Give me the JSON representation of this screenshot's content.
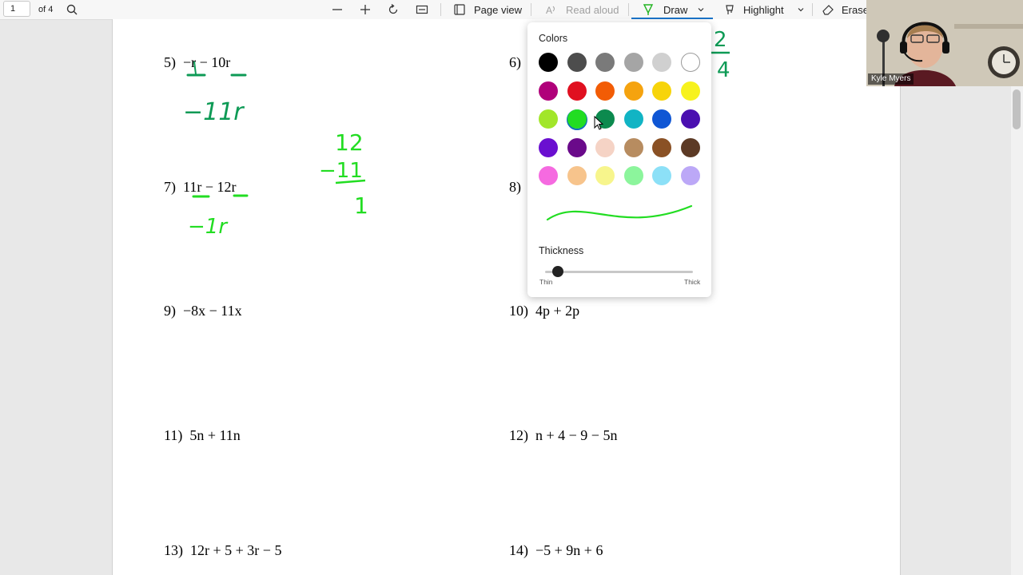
{
  "toolbar": {
    "page_number": "1",
    "page_count": "of 4",
    "page_view": "Page view",
    "read_aloud": "Read aloud",
    "draw": "Draw",
    "highlight": "Highlight",
    "erase": "Erase"
  },
  "problems": [
    {
      "label": "5)",
      "expr": "−r − 10r"
    },
    {
      "label": "6)",
      "expr": ""
    },
    {
      "label": "7)",
      "expr": "11r − 12r"
    },
    {
      "label": "8)",
      "expr": ""
    },
    {
      "label": "9)",
      "expr": "−8x − 11x"
    },
    {
      "label": "10)",
      "expr": "4p + 2p"
    },
    {
      "label": "11)",
      "expr": "5n + 11n"
    },
    {
      "label": "12)",
      "expr": "n + 4 − 9 − 5n"
    },
    {
      "label": "13)",
      "expr": "12r + 5 + 3r − 5"
    },
    {
      "label": "14)",
      "expr": "−5 + 9n + 6"
    }
  ],
  "handwriting": {
    "p5": "−11r",
    "p7": "−1r",
    "side_top": "12",
    "side_mid": "−11",
    "side_bottom": "1",
    "corner_top": "2",
    "corner_bottom": "4"
  },
  "popup": {
    "colors_title": "Colors",
    "thickness_title": "Thickness",
    "thin": "Thin",
    "thick": "Thick",
    "selected_color": "#22dd22",
    "thickness_level": 0.05,
    "colors": [
      [
        "#000000",
        "#4d4d4d",
        "#7a7a7a",
        "#a5a5a5",
        "#d0d0d0",
        "#ffffff"
      ],
      [
        "#b0007a",
        "#e01020",
        "#f25c05",
        "#f5a30f",
        "#f7d40a",
        "#f7f21d"
      ],
      [
        "#a2e62a",
        "#22dd22",
        "#0c8a4e",
        "#11b4c4",
        "#0f56d4",
        "#4a0fb0"
      ],
      [
        "#6a0fd0",
        "#6a0a8a",
        "#f5d3c5",
        "#b78c60",
        "#8a5125",
        "#5c3a25"
      ],
      [
        "#f56ae0",
        "#f7c48c",
        "#f7f58c",
        "#8cf59c",
        "#8ce0f7",
        "#bca8f7"
      ]
    ]
  },
  "webcam": {
    "name": "Kyle Myers"
  }
}
